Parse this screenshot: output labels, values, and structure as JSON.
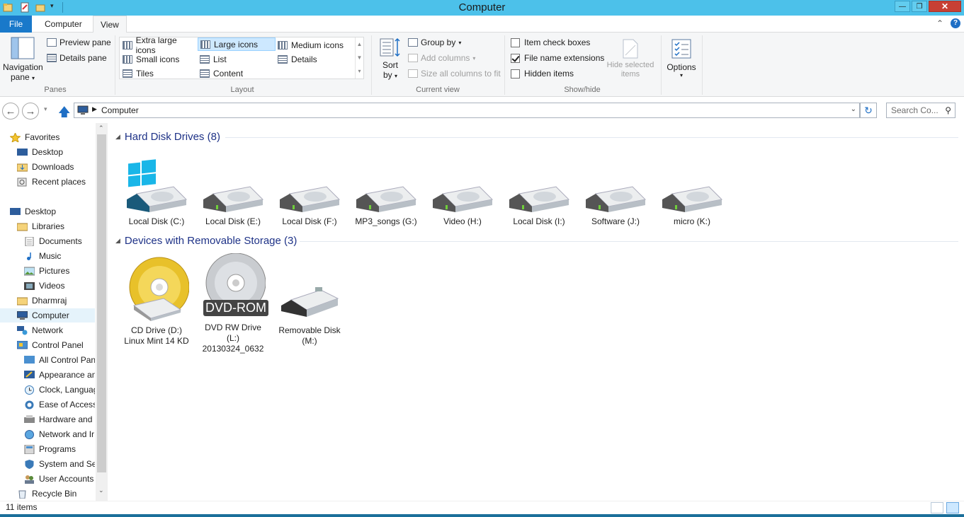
{
  "window": {
    "title": "Computer",
    "close_label": "✕",
    "max_label": "❐",
    "min_label": "—"
  },
  "tabs": {
    "file": "File",
    "computer": "Computer",
    "view": "View"
  },
  "ribbon": {
    "panes": {
      "nav_pane": "Navigation",
      "nav_pane2": "pane",
      "preview_pane": "Preview pane",
      "details_pane": "Details pane",
      "label": "Panes"
    },
    "layout": {
      "extra_large": "Extra large icons",
      "large": "Large icons",
      "medium": "Medium icons",
      "small": "Small icons",
      "list": "List",
      "details": "Details",
      "tiles": "Tiles",
      "content": "Content",
      "label": "Layout"
    },
    "current_view": {
      "sort": "Sort",
      "sort2": "by",
      "group_by": "Group by",
      "add_columns": "Add columns",
      "size_columns": "Size all columns to fit",
      "label": "Current view"
    },
    "show_hide": {
      "item_check_boxes": "Item check boxes",
      "file_ext": "File name extensions",
      "hidden_items": "Hidden items",
      "hide_selected": "Hide selected",
      "hide_selected2": "items",
      "label": "Show/hide",
      "item_check_boxes_checked": false,
      "file_ext_checked": true,
      "hidden_items_checked": false
    },
    "options": {
      "label": "Options"
    }
  },
  "address": {
    "path": "Computer",
    "search_placeholder": "Search Co..."
  },
  "nav": {
    "favorites": "Favorites",
    "fav_items": [
      "Desktop",
      "Downloads",
      "Recent places"
    ],
    "desktop": "Desktop",
    "libraries": "Libraries",
    "lib_items": [
      "Documents",
      "Music",
      "Pictures",
      "Videos"
    ],
    "user": "Dharmraj",
    "computer": "Computer",
    "network": "Network",
    "control_panel": "Control Panel",
    "cp_items": [
      "All Control Pan",
      "Appearance an",
      "Clock, Languag",
      "Ease of Access",
      "Hardware and S",
      "Network and Ir",
      "Programs",
      "System and Sec",
      "User Accounts"
    ],
    "recycle": "Recycle Bin"
  },
  "groups": {
    "hdd_title": "Hard Disk Drives (8)",
    "removable_title": "Devices with Removable Storage (3)"
  },
  "drives": [
    "Local Disk (C:)",
    "Local Disk (E:)",
    "Local Disk (F:)",
    "MP3_songs (G:)",
    "Video (H:)",
    "Local Disk (I:)",
    "Software (J:)",
    "micro (K:)"
  ],
  "removable": [
    {
      "line1": "CD Drive (D:)",
      "line2": "Linux Mint 14 KD",
      "line3": ""
    },
    {
      "line1": "DVD RW Drive",
      "line2": "(L:)",
      "line3": "20130324_0632",
      "badge": "DVD-ROM"
    },
    {
      "line1": "Removable Disk",
      "line2": "(M:)",
      "line3": ""
    }
  ],
  "status": {
    "items": "11 items"
  },
  "colors": {
    "titlebar": "#4cc1ea",
    "file_tab": "#1979ca",
    "group_title": "#1e3287",
    "selection": "#cde8ff"
  }
}
